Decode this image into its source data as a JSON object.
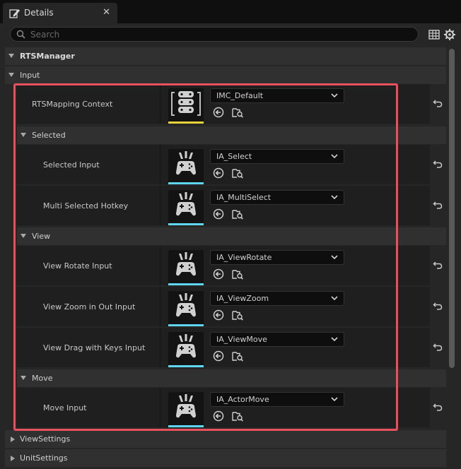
{
  "tab": {
    "title": "Details",
    "icon": "pencil-icon",
    "close_glyph": "✕"
  },
  "search": {
    "placeholder": "Search",
    "value": ""
  },
  "toolbar": {
    "icons": [
      "table-view-icon",
      "settings-gear-icon"
    ]
  },
  "categories": {
    "root": "RTSManager",
    "input": "Input",
    "selected": "Selected",
    "view": "View",
    "move": "Move",
    "view_settings": "ViewSettings",
    "unit_settings": "UnitSettings"
  },
  "properties": [
    {
      "label": "RTSMapping Context",
      "value": "IMC_Default",
      "asset_type": "input-mapping-context",
      "accent": "#e8d33a"
    },
    {
      "label": "Selected Input",
      "value": "IA_Select",
      "asset_type": "input-action",
      "accent": "#5fd6f0"
    },
    {
      "label": "Multi Selected Hotkey",
      "value": "IA_MultiSelect",
      "asset_type": "input-action",
      "accent": "#5fd6f0"
    },
    {
      "label": "View Rotate Input",
      "value": "IA_ViewRotate",
      "asset_type": "input-action",
      "accent": "#5fd6f0"
    },
    {
      "label": "View Zoom in Out Input",
      "value": "IA_ViewZoom",
      "asset_type": "input-action",
      "accent": "#5fd6f0"
    },
    {
      "label": "View Drag with Keys Input",
      "value": "IA_ViewMove",
      "asset_type": "input-action",
      "accent": "#5fd6f0"
    },
    {
      "label": "Move Input",
      "value": "IA_ActorMove",
      "asset_type": "input-action",
      "accent": "#5fd6f0"
    }
  ],
  "colors": {
    "highlight": "#e8505b",
    "panel": "#262626",
    "field": "#0e0e0e"
  }
}
